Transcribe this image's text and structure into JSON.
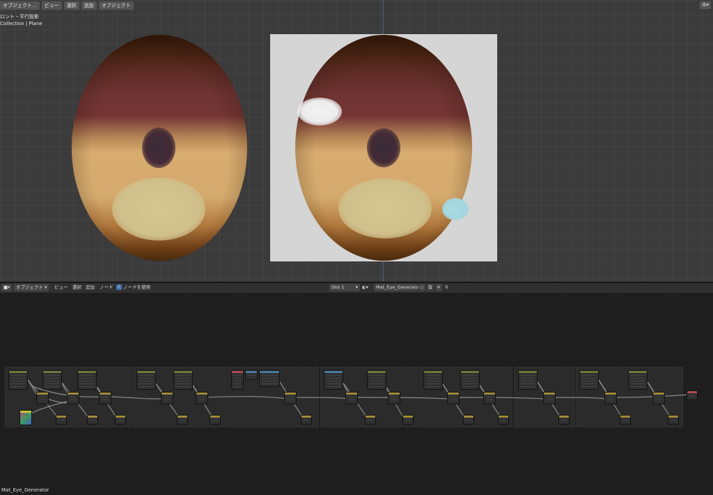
{
  "viewport": {
    "menu": {
      "mode": "オブジェクト...",
      "view": "ビュー",
      "select": "選択",
      "add": "追加",
      "object": "オブジェクト"
    },
    "view_name": "ロント・平行投影",
    "collection_info": "Collection | Plane",
    "corner_icon": "⚙▾"
  },
  "node_editor": {
    "header": {
      "editor_icon": "■▾",
      "mode": "オブジェクト",
      "view": "ビュー",
      "select": "選択",
      "add": "追加",
      "node": "ノード",
      "use_nodes_label": "ノードを使用",
      "use_nodes_checked": "✓",
      "slot": "Slot 1",
      "material_icon": "◐",
      "material_name": "Mat_Eye_Generator",
      "shield_icon": "◇",
      "copy_icon": "⧉",
      "close_icon": "✕",
      "pin_icon": "⚲"
    },
    "material_label": "Mat_Eye_Generator"
  },
  "colors": {
    "viewport_bg": "#3b3b3b",
    "node_header_input": "#6b7a3a",
    "node_header_mix": "#a08a3a",
    "node_header_color": "#c8c23a",
    "node_header_texture": "#4a7ba0",
    "node_header_output": "#b04a5a",
    "wire": "#9a9a9a"
  }
}
